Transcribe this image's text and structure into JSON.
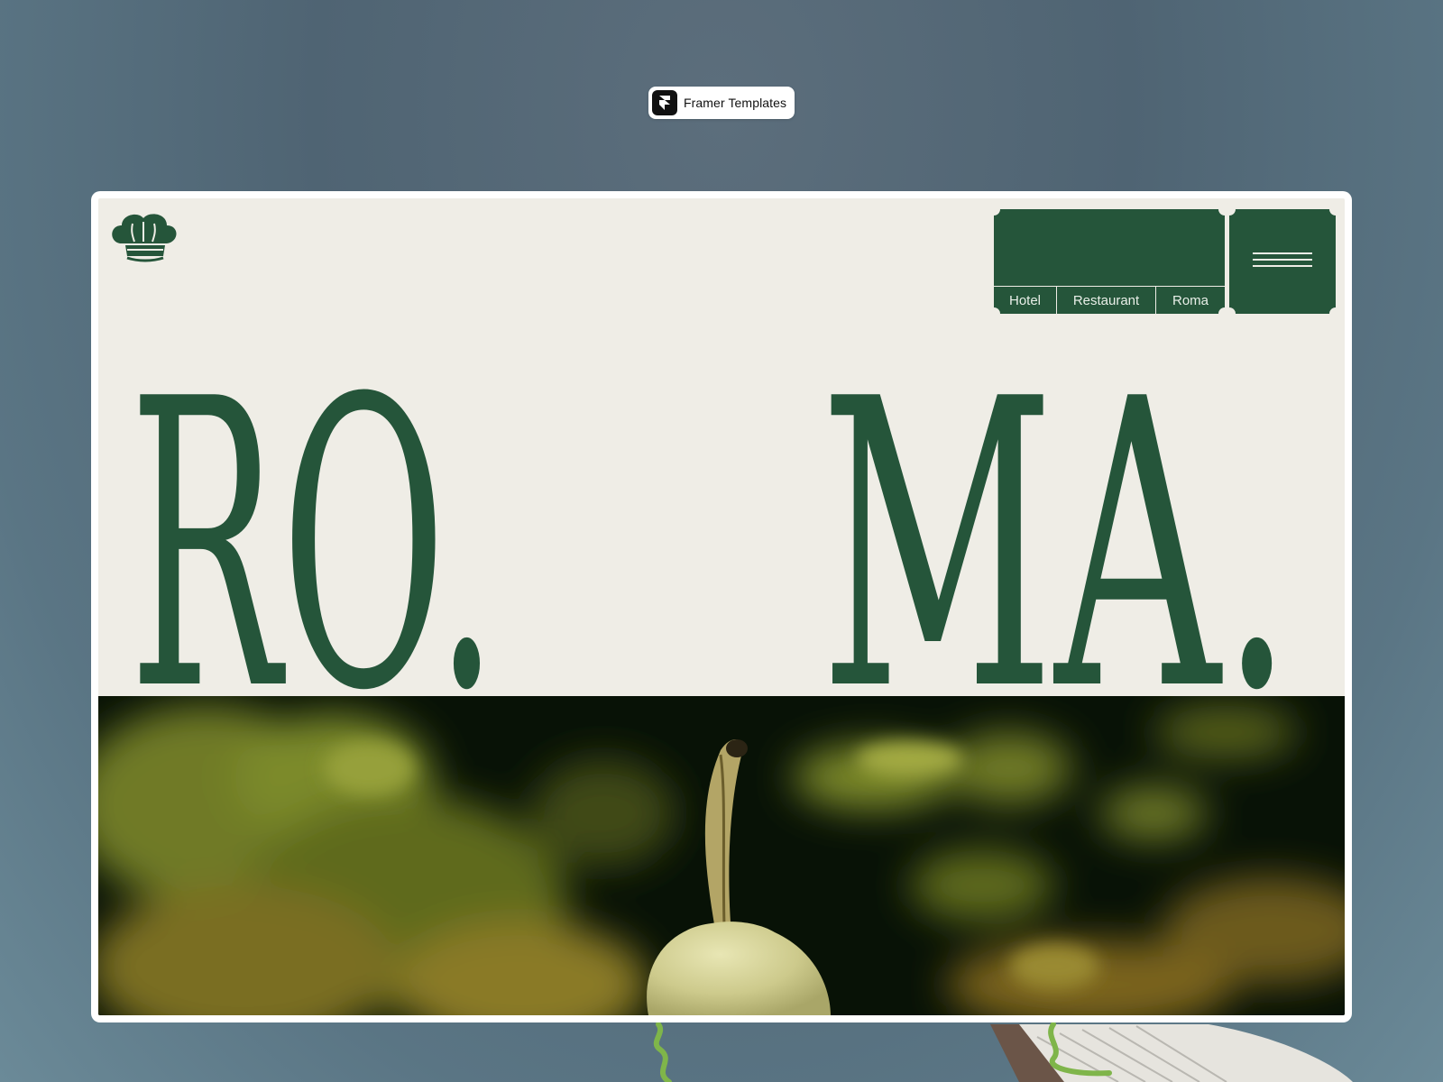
{
  "badge": {
    "label": "Framer Templates",
    "icon": "framer-logo-icon"
  },
  "header": {
    "logo_icon": "chef-hat-icon",
    "nav_tabs": [
      {
        "label": "Hotel"
      },
      {
        "label": "Restaurant"
      },
      {
        "label": "Roma"
      }
    ],
    "menu_icon": "hamburger-menu-icon"
  },
  "hero": {
    "title_left": "RO.",
    "title_right": "MA."
  },
  "colors": {
    "brand_green": "#25553a",
    "page_bg": "#efede6",
    "outer_bg": "#566d7b"
  }
}
